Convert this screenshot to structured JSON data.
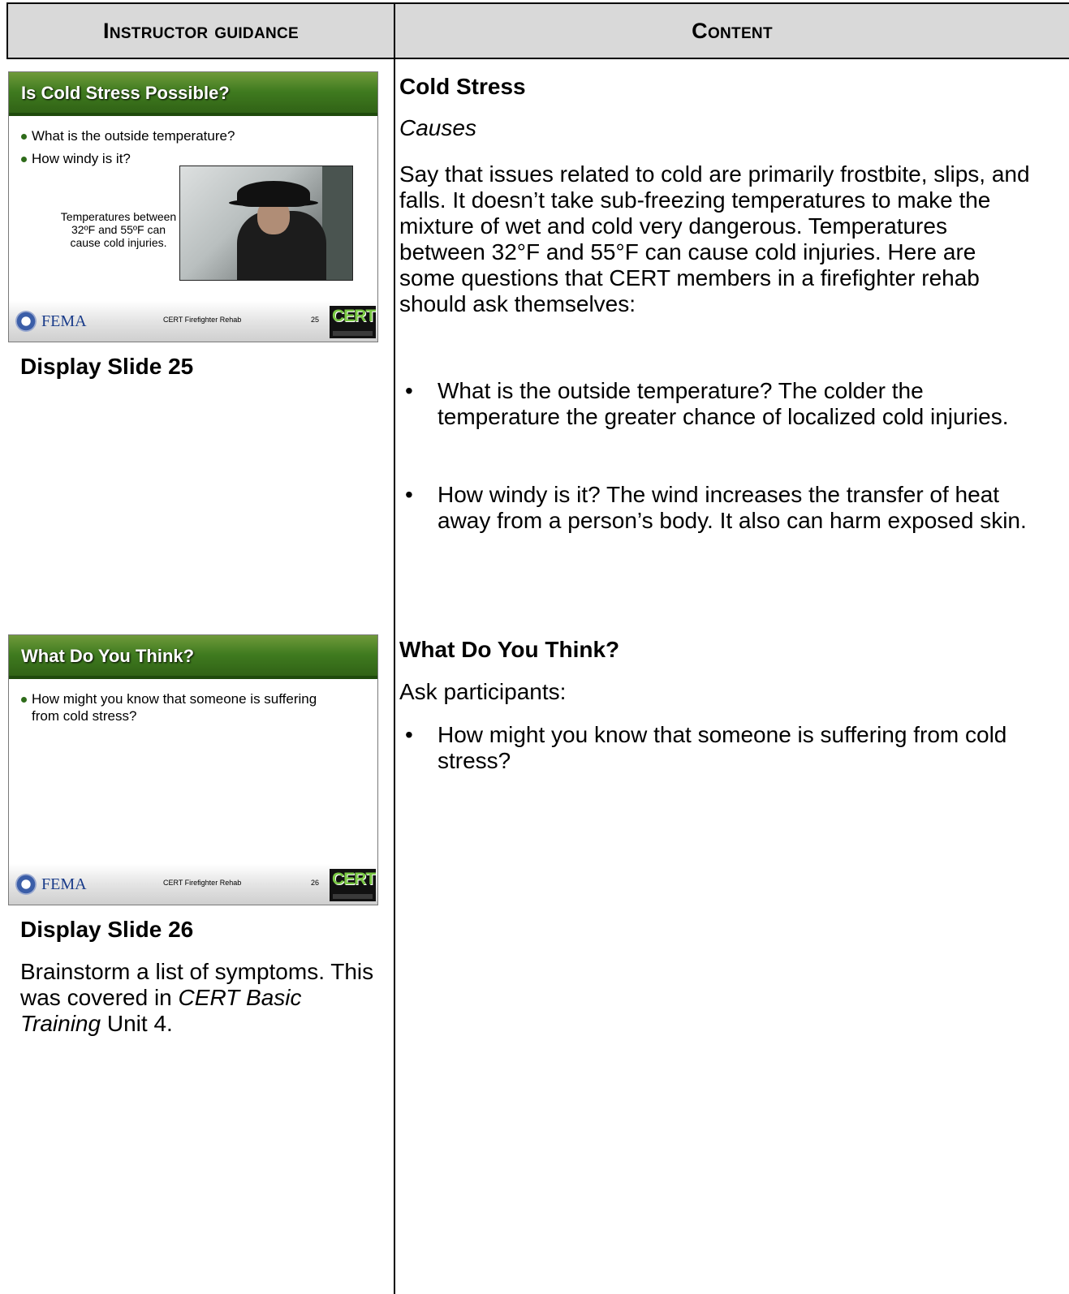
{
  "header": {
    "left": "Instructor guidance",
    "right": "Content"
  },
  "slide25": {
    "title": "Is Cold Stress Possible?",
    "bullets": [
      "What is the outside temperature?",
      "How windy is it?"
    ],
    "photo_caption": "Temperatures between 32ºF and 55ºF can cause cold injuries.",
    "footer_org": "FEMA",
    "footer_course": "CERT Firefighter Rehab",
    "footer_number": "25",
    "logo_text": "CERT"
  },
  "slide26": {
    "title": "What Do You Think?",
    "bullets": [
      "How might you know that someone is suffering from cold stress?"
    ],
    "footer_org": "FEMA",
    "footer_course": "CERT Firefighter Rehab",
    "footer_number": "26",
    "logo_text": "CERT"
  },
  "left": {
    "display25": "Display Slide 25",
    "display26": "Display Slide 26",
    "brainstorm_a": "Brainstorm a list of symptoms. This was covered in ",
    "brainstorm_italic1": "CERT",
    "brainstorm_italic2": "Basic Training",
    "brainstorm_b": " Unit 4."
  },
  "content": {
    "section1_heading": "Cold Stress",
    "section1_sub": "Causes",
    "section1_para": "Say that issues related to cold are primarily frostbite, slips, and falls.  It doesn’t take sub-freezing temperatures to make the mixture of wet and cold very dangerous.  Temperatures between 32°F and 55°F can cause cold injuries.  Here are some questions that CERT members in a firefighter rehab should ask themselves:",
    "section1_bullets": [
      "What is the outside temperature?  The colder the temperature the greater chance of localized cold injuries.",
      "How windy is it?  The wind increases the transfer of heat away from a person’s body. It also can harm exposed skin."
    ],
    "section2_heading": "What Do You Think?",
    "section2_intro": "Ask participants:",
    "section2_bullets": [
      "How might you know that someone is suffering from cold stress?"
    ]
  }
}
